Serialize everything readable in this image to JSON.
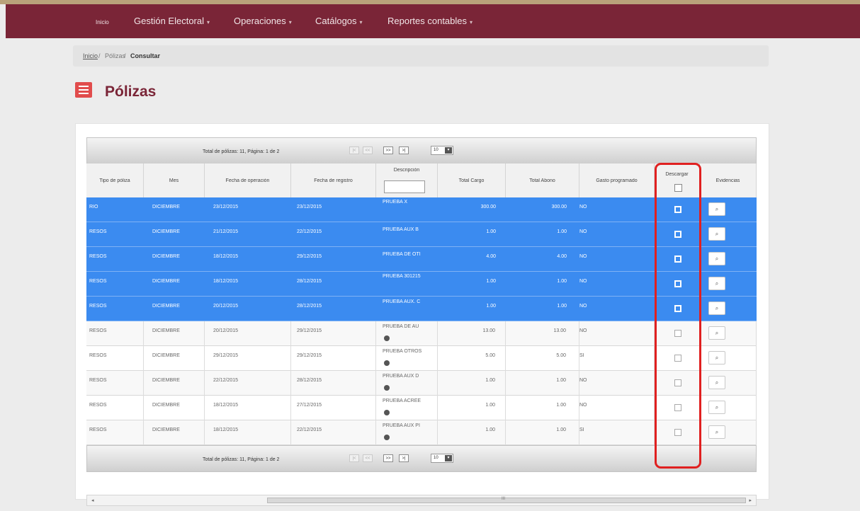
{
  "nav": {
    "home": "Inicio",
    "items": [
      "Gestión Electoral",
      "Operaciones",
      "Catálogos",
      "Reportes contables"
    ]
  },
  "breadcrumb": {
    "home": "Inicio",
    "section": "Pólizas",
    "current": "Consultar"
  },
  "page": {
    "title": "Pólizas"
  },
  "pager": {
    "summary": "Total de pólizas: 11, Página: 1 de 2",
    "page_size": "10",
    "first": "|<",
    "prev": "<<",
    "next": ">>",
    "last": ">|"
  },
  "columns": [
    "Tipo de póliza",
    "Mes",
    "Fecha de operación",
    "Fecha de registro",
    "Descripción",
    "Total Cargo",
    "Total Abono",
    "Gasto programado",
    "Descargar",
    "Evidencias"
  ],
  "rows": [
    {
      "tipo": "RIO",
      "mes": "DICIEMBRE",
      "fop": "23/12/2015",
      "freg": "23/12/2015",
      "desc": "PRUEBA X",
      "cargo": "300.00",
      "abono": "300.00",
      "gasto": "NO",
      "selected": true,
      "checked": true
    },
    {
      "tipo": "RESOS",
      "mes": "DICIEMBRE",
      "fop": "21/12/2015",
      "freg": "22/12/2015",
      "desc": "PRUEBA AUX B",
      "cargo": "1.00",
      "abono": "1.00",
      "gasto": "NO",
      "selected": true,
      "checked": true
    },
    {
      "tipo": "RESOS",
      "mes": "DICIEMBRE",
      "fop": "18/12/2015",
      "freg": "29/12/2015",
      "desc": "PRUEBA DE OTI",
      "cargo": "4.00",
      "abono": "4.00",
      "gasto": "NO",
      "selected": true,
      "checked": true
    },
    {
      "tipo": "RESOS",
      "mes": "DICIEMBRE",
      "fop": "18/12/2015",
      "freg": "28/12/2015",
      "desc": "PRUEBA 301215",
      "cargo": "1.00",
      "abono": "1.00",
      "gasto": "NO",
      "selected": true,
      "checked": true
    },
    {
      "tipo": "RESOS",
      "mes": "DICIEMBRE",
      "fop": "20/12/2015",
      "freg": "28/12/2015",
      "desc": "PRUEBA AUX. C",
      "cargo": "1.00",
      "abono": "1.00",
      "gasto": "NO",
      "selected": true,
      "checked": true
    },
    {
      "tipo": "RESOS",
      "mes": "DICIEMBRE",
      "fop": "20/12/2015",
      "freg": "29/12/2015",
      "desc": "PRUEBA DE AU",
      "cargo": "13.00",
      "abono": "13.00",
      "gasto": "NO",
      "selected": false,
      "checked": false
    },
    {
      "tipo": "RESOS",
      "mes": "DICIEMBRE",
      "fop": "29/12/2015",
      "freg": "29/12/2015",
      "desc": "PRUEBA OTROS",
      "cargo": "5.00",
      "abono": "5.00",
      "gasto": "SI",
      "selected": false,
      "checked": false
    },
    {
      "tipo": "RESOS",
      "mes": "DICIEMBRE",
      "fop": "22/12/2015",
      "freg": "28/12/2015",
      "desc": "PRUEBA AUX D",
      "cargo": "1.00",
      "abono": "1.00",
      "gasto": "NO",
      "selected": false,
      "checked": false
    },
    {
      "tipo": "RESOS",
      "mes": "DICIEMBRE",
      "fop": "18/12/2015",
      "freg": "27/12/2015",
      "desc": "PRUEBA ACREE",
      "cargo": "1.00",
      "abono": "1.00",
      "gasto": "NO",
      "selected": false,
      "checked": false
    },
    {
      "tipo": "RESOS",
      "mes": "DICIEMBRE",
      "fop": "18/12/2015",
      "freg": "22/12/2015",
      "desc": "PRUEBA AUX PI",
      "cargo": "1.00",
      "abono": "1.00",
      "gasto": "SI",
      "selected": false,
      "checked": false
    }
  ],
  "scrollbar": {
    "thumb_label": "III"
  },
  "icons": {
    "menu": "menu-icon",
    "evidence": "search-icon",
    "info": "info-icon"
  },
  "colors": {
    "nav": "#7a2537",
    "selected_row": "#3b8bf0",
    "highlight": "#e02020",
    "menu_icon": "#e14c4c"
  }
}
